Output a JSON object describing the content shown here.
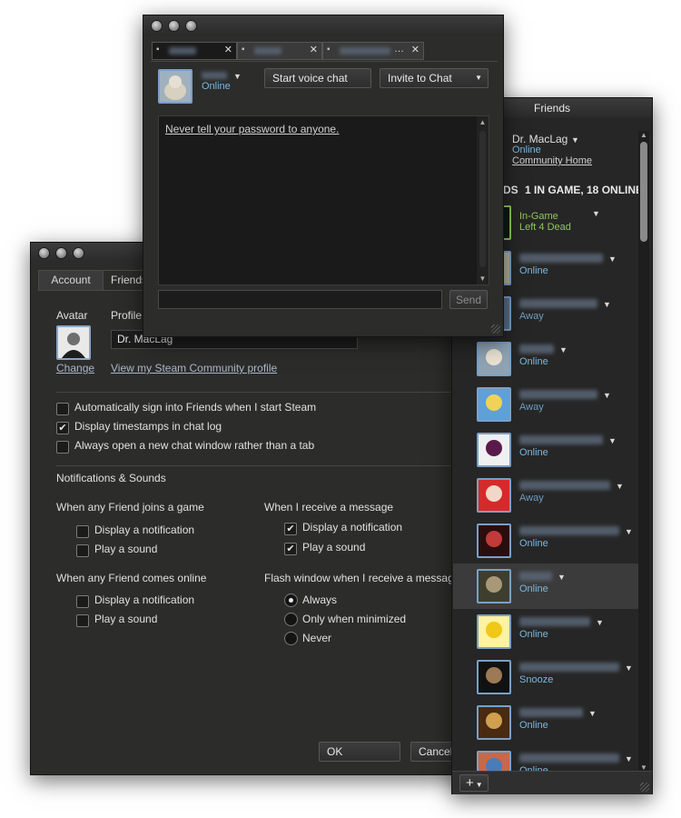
{
  "settings": {
    "tabs": [
      {
        "label": "Account",
        "active": false
      },
      {
        "label": "Friends",
        "active": true
      }
    ],
    "avatar_label": "Avatar",
    "profile_label": "Profile",
    "profile_name_value": "Dr. MacLag",
    "change_link": "Change",
    "view_profile_link": "View my Steam Community profile",
    "options": [
      {
        "label": "Automatically sign into Friends when I start Steam",
        "checked": false
      },
      {
        "label": "Display timestamps in chat log",
        "checked": true
      },
      {
        "label": "Always open a new chat window rather than a tab",
        "checked": false
      }
    ],
    "notifications_heading": "Notifications & Sounds",
    "joins_game": {
      "heading": "When any Friend joins a game",
      "display": {
        "label": "Display a notification",
        "checked": false
      },
      "sound": {
        "label": "Play a sound",
        "checked": false
      }
    },
    "receive_message": {
      "heading": "When I receive a message",
      "display": {
        "label": "Display a notification",
        "checked": true
      },
      "sound": {
        "label": "Play a sound",
        "checked": true
      }
    },
    "comes_online": {
      "heading": "When any Friend comes online",
      "display": {
        "label": "Display a notification",
        "checked": false
      },
      "sound": {
        "label": "Play a sound",
        "checked": false
      }
    },
    "flash_window": {
      "heading": "Flash window when I receive a message",
      "options": [
        {
          "label": "Always",
          "selected": true
        },
        {
          "label": "Only when minimized",
          "selected": false
        },
        {
          "label": "Never",
          "selected": false
        }
      ]
    },
    "ok_button": "OK",
    "cancel_button": "Cancel"
  },
  "chat": {
    "status": "Online",
    "start_voice_button": "Start voice chat",
    "invite_button": "Invite to Chat",
    "message_link": "Never tell your password to anyone.",
    "input_value": "",
    "send_button": "Send",
    "tab_count": 3
  },
  "friends": {
    "title": "Friends",
    "user_name": "Dr. MacLag",
    "user_status": "Online",
    "community_link": "Community Home",
    "header_partial": "DS",
    "header_counts": "1 IN GAME, 18 ONLINE",
    "list": [
      {
        "status": "In-Game",
        "game": "Left 4 Dead",
        "kind": "game",
        "avatar": "green-frame"
      },
      {
        "status": "Online",
        "kind": "online",
        "avatar": "cartoon"
      },
      {
        "status": "Away",
        "kind": "away",
        "avatar": "dark-figure"
      },
      {
        "status": "Online",
        "kind": "online",
        "avatar": "cat"
      },
      {
        "status": "Away",
        "kind": "away",
        "avatar": "blonde-girl"
      },
      {
        "status": "Online",
        "kind": "online",
        "avatar": "vampire"
      },
      {
        "status": "Away",
        "kind": "away",
        "avatar": "red-hair"
      },
      {
        "status": "Online",
        "kind": "online",
        "avatar": "zero-logo"
      },
      {
        "status": "Online",
        "kind": "online",
        "avatar": "soldier",
        "selected": true
      },
      {
        "status": "Online",
        "kind": "online",
        "avatar": "yellow-face"
      },
      {
        "status": "Snooze",
        "kind": "online",
        "avatar": "hammer"
      },
      {
        "status": "Online",
        "kind": "online",
        "avatar": "brown-figure"
      },
      {
        "status": "Online",
        "kind": "online",
        "avatar": "colorful"
      }
    ],
    "add_button": "+"
  },
  "colors": {
    "window_bg": "#2c2c2b",
    "link_blue": "#aab7c8",
    "online_blue": "#7ab8e0",
    "ingame_green": "#8fc65c"
  }
}
